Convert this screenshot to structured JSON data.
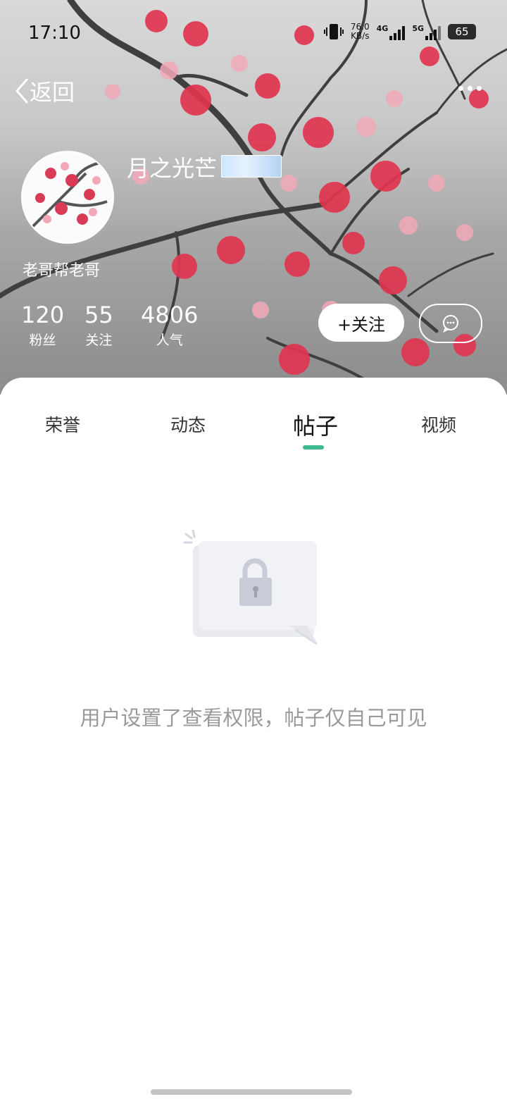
{
  "status_bar": {
    "time": "17:10",
    "net_speed_value": "76.0",
    "net_speed_unit": "KB/s",
    "signal1_label": "4G",
    "signal2_label": "5G",
    "battery": "65"
  },
  "nav": {
    "back_label": "返回"
  },
  "profile": {
    "username": "月之光芒",
    "bio": "老哥帮老哥",
    "stats": [
      {
        "value": "120",
        "label": "粉丝"
      },
      {
        "value": "55",
        "label": "关注"
      },
      {
        "value": "4806",
        "label": "人气"
      }
    ],
    "follow_label": "+关注"
  },
  "tabs": [
    {
      "label": "荣誉"
    },
    {
      "label": "动态"
    },
    {
      "label": "帖子",
      "active": true
    },
    {
      "label": "视频"
    }
  ],
  "empty_state": {
    "message": "用户设置了查看权限，帖子仅自己可见"
  },
  "colors": {
    "accent": "#3dbb8f",
    "blossom": "#e0354f",
    "muted_text": "#9a9a9a"
  }
}
